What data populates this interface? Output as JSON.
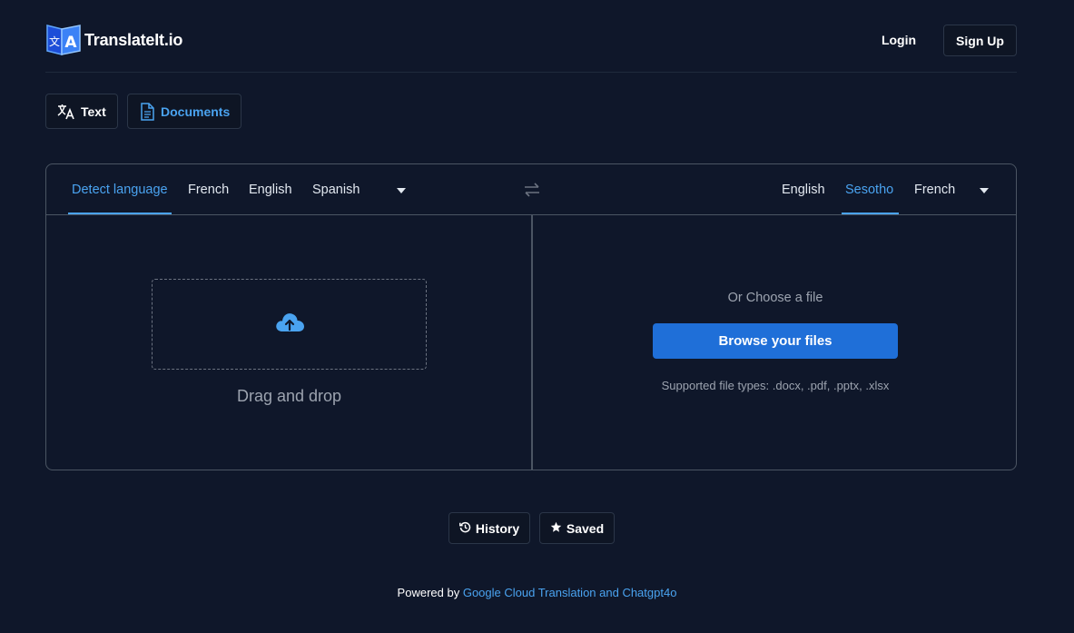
{
  "header": {
    "brand": "TranslateIt.io",
    "login_label": "Login",
    "signup_label": "Sign Up"
  },
  "mode_tabs": [
    {
      "label": "Text",
      "icon": "translate-icon",
      "active": false
    },
    {
      "label": "Documents",
      "icon": "document-icon",
      "active": true
    }
  ],
  "source_languages": {
    "items": [
      "Detect language",
      "French",
      "English",
      "Spanish"
    ],
    "active": "Detect language"
  },
  "target_languages": {
    "items": [
      "English",
      "Sesotho",
      "French"
    ],
    "active": "Sesotho"
  },
  "upload": {
    "drag_label": "Drag and drop",
    "choose_label": "Or Choose a file",
    "browse_label": "Browse your files",
    "supported_types": "Supported file types: .docx, .pdf, .pptx, .xlsx"
  },
  "actions": {
    "history_label": "History",
    "saved_label": "Saved"
  },
  "footer": {
    "prefix": "Powered by",
    "link_text": "Google Cloud Translation and Chatgpt4o"
  },
  "colors": {
    "background": "#0f172a",
    "accent": "#4aa3f0",
    "primary_button": "#1f6fd8",
    "border": "#4b5563"
  }
}
